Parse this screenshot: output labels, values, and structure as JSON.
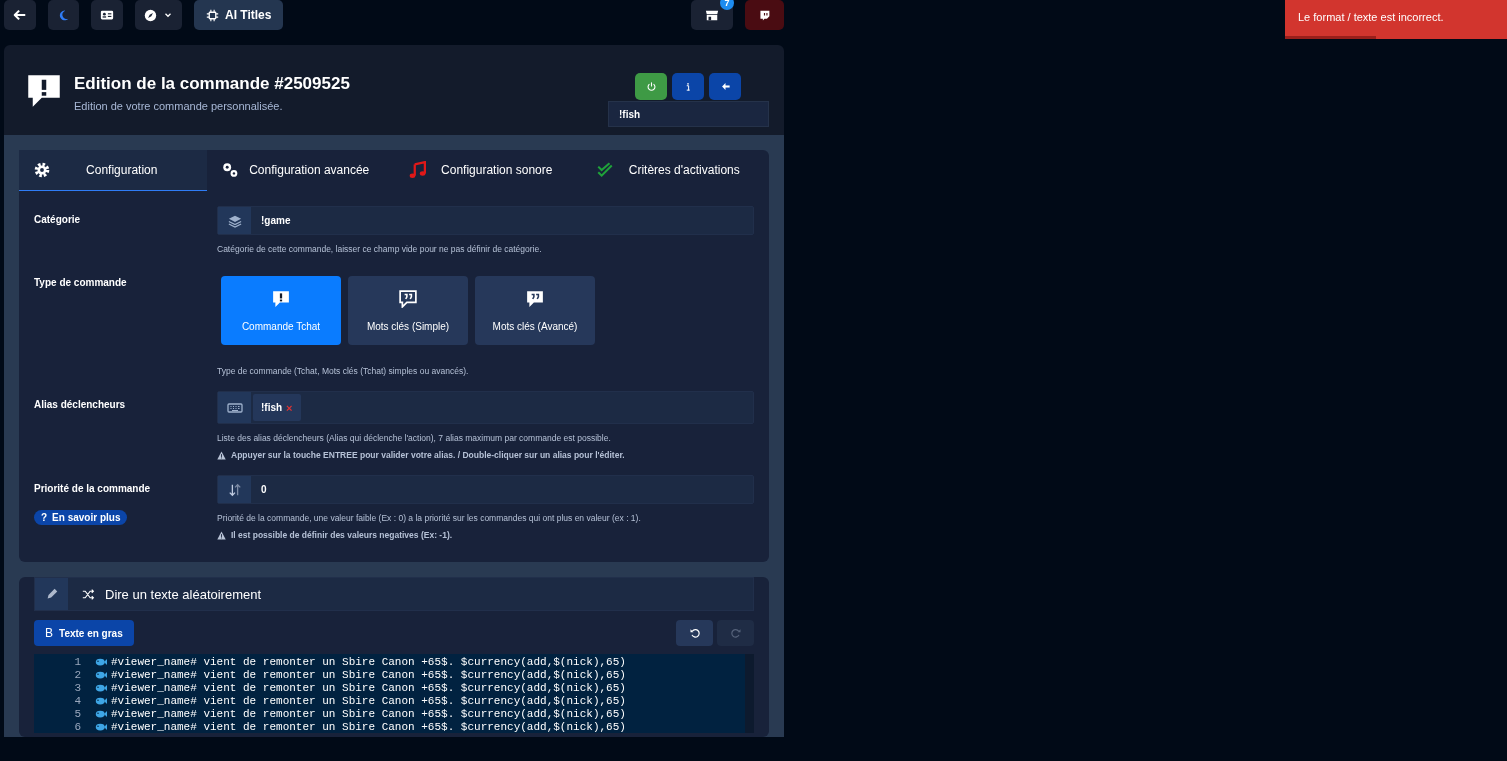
{
  "topbar": {
    "ai_button": "AI Titles",
    "notification_count": "7"
  },
  "toast": {
    "message": "Le format / texte est incorrect.",
    "level": 0.41
  },
  "header": {
    "title": "Edition de la commande #2509525",
    "subtitle": "Edition de votre commande personnalisée.",
    "search_value": "!fish"
  },
  "tabs": [
    {
      "label": "Configuration",
      "selected": true
    },
    {
      "label": "Configuration avancée",
      "selected": false
    },
    {
      "label": "Configuration sonore",
      "selected": false
    },
    {
      "label": "Critères d'activations",
      "selected": false
    }
  ],
  "fields": [
    {
      "kind": "category",
      "label": "Catégorie",
      "value": "!game",
      "help": "Catégorie de cette commande, laisser ce champ vide pour ne pas définir de catégorie."
    },
    {
      "kind": "choice",
      "label": "Type de commande",
      "options": [
        {
          "label": "Commande Tchat",
          "selected": true
        },
        {
          "label": "Mots clés (Simple)",
          "selected": false
        },
        {
          "label": "Mots clés (Avancé)",
          "selected": false
        }
      ],
      "help": "Type de commande (Tchat, Mots clés (Tchat) simples ou avancés)."
    },
    {
      "kind": "tags",
      "label": "Alias déclencheurs",
      "tags": [
        {
          "label": "!fish",
          "remove_glyph": "×"
        }
      ],
      "help": "Liste des alias déclencheurs (Alias qui déclenche l'action), 7 alias maximum par commande est possible.",
      "warning": "Appuyer sur la touche ENTREE pour valider votre alias. / Double-cliquer sur un alias pour l'éditer."
    },
    {
      "kind": "priority",
      "label": "Priorité de la commande",
      "value": "0",
      "link_glyph": "?",
      "link": "En savoir plus",
      "help": "Priorité de la commande, une valeur faible (Ex : 0) a la priorité sur les commandes qui ont plus en valeur (ex : 1).",
      "warning": "Il est possible de définir des valeurs negatives (Ex: -1)."
    }
  ],
  "response": {
    "title": "Dire un texte aléatoirement",
    "bold_glyph": "B",
    "bold_button": "Texte en gras",
    "undo_disabled": false,
    "redo_disabled": true,
    "lines": [
      {
        "number": "1",
        "text": "#viewer_name# vient de remonter un Sbire Canon +65$. $currency(add,$(nick),65)"
      },
      {
        "number": "2",
        "text": "#viewer_name# vient de remonter un Sbire Canon +65$. $currency(add,$(nick),65)"
      },
      {
        "number": "3",
        "text": "#viewer_name# vient de remonter un Sbire Canon +65$. $currency(add,$(nick),65)"
      },
      {
        "number": "4",
        "text": "#viewer_name# vient de remonter un Sbire Canon +65$. $currency(add,$(nick),65)"
      },
      {
        "number": "5",
        "text": "#viewer_name# vient de remonter un Sbire Canon +65$. $currency(add,$(nick),65)"
      },
      {
        "number": "6",
        "text": "#viewer_name# vient de remonter un Sbire Canon +65$. $currency(add,$(nick),65)"
      }
    ]
  }
}
